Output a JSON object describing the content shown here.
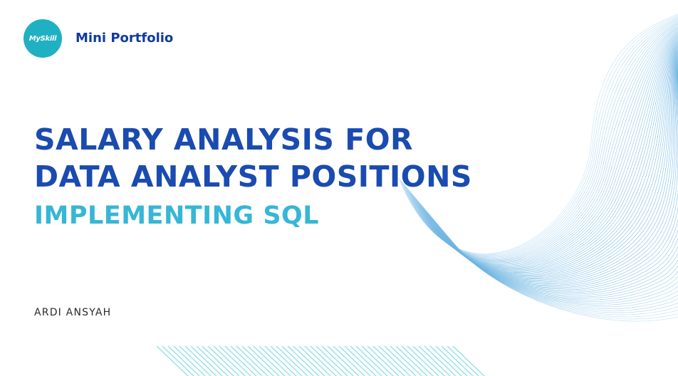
{
  "brand": {
    "logo_text": "MySkill",
    "label": "Mini Portfolio"
  },
  "title": {
    "line1": "SALARY ANALYSIS FOR",
    "line2": "DATA ANALYST POSITIONS"
  },
  "subtitle": "IMPLEMENTING SQL",
  "author": "ARDI ANSYAH",
  "colors": {
    "title": "#1a4bb0",
    "brand_label": "#0f3b9e",
    "subtitle": "#37b6d6",
    "logo": "#1fb1c2",
    "wave": "#6fb6e2",
    "stripes": "#8fdfe6"
  }
}
